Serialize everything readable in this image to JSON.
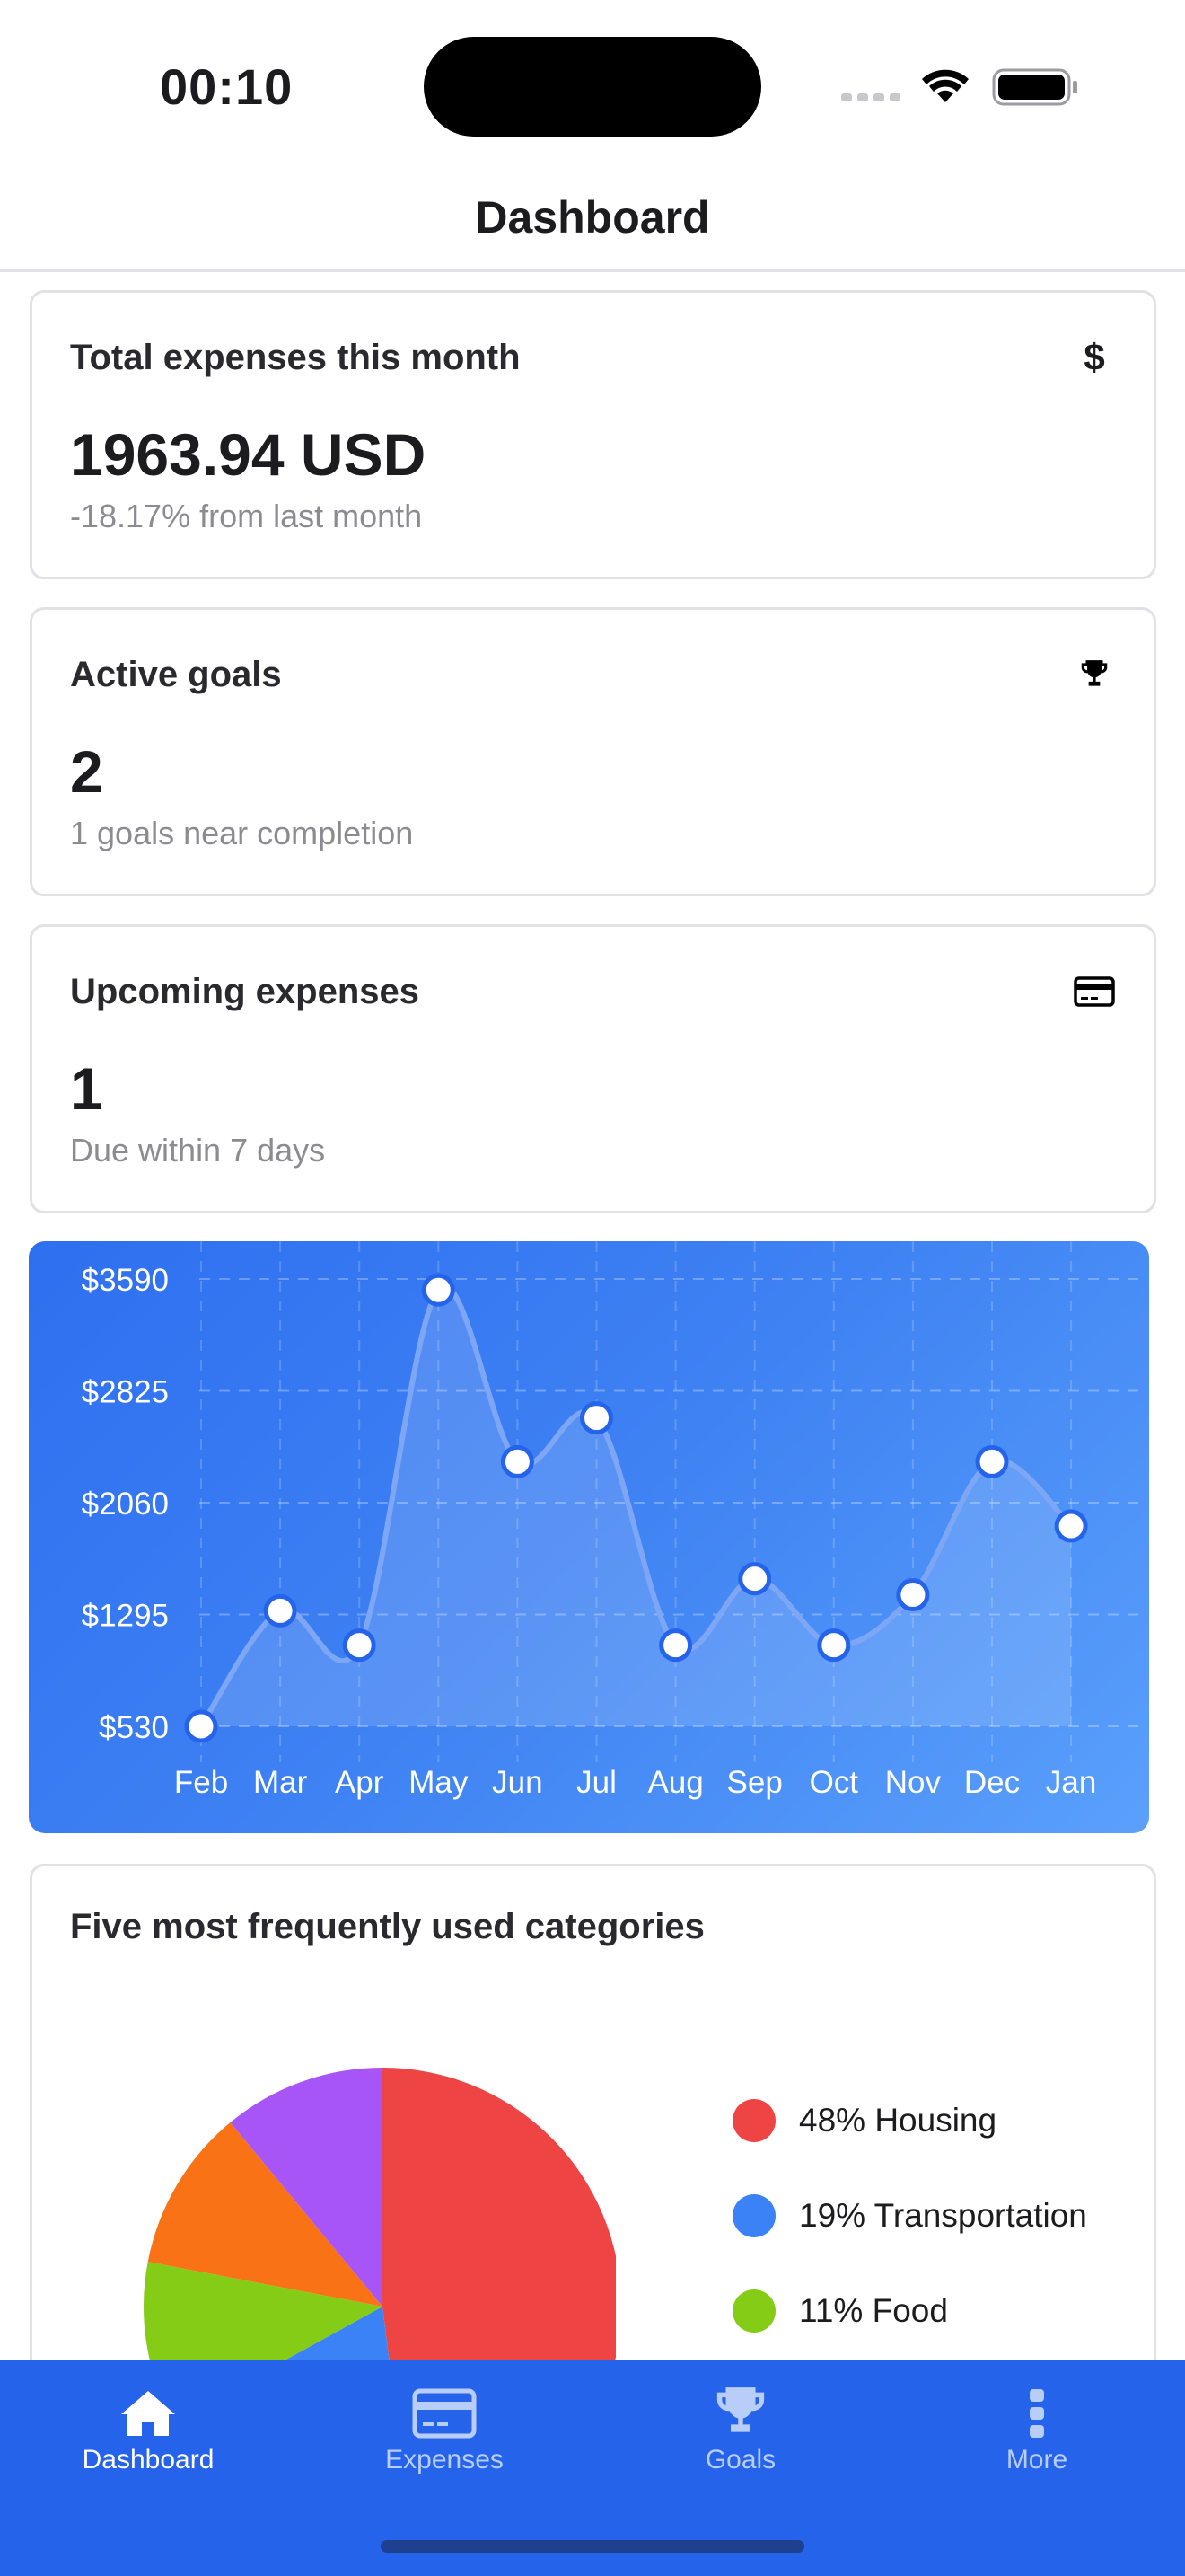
{
  "status_bar": {
    "time": "00:10"
  },
  "header": {
    "title": "Dashboard"
  },
  "cards": [
    {
      "title": "Total expenses this month",
      "value": "1963.94 USD",
      "subtitle": "-18.17% from last month",
      "icon": "dollar-icon",
      "icon_glyph": "$"
    },
    {
      "title": "Active goals",
      "value": "2",
      "subtitle": "1 goals near completion",
      "icon": "trophy-icon"
    },
    {
      "title": "Upcoming expenses",
      "value": "1",
      "subtitle": "Due within 7 days",
      "icon": "credit-card-icon"
    }
  ],
  "chart_data": {
    "type": "line",
    "categories": [
      "Feb",
      "Mar",
      "Apr",
      "May",
      "Jun",
      "Jul",
      "Aug",
      "Sep",
      "Oct",
      "Nov",
      "Dec",
      "Jan"
    ],
    "values": [
      530,
      1320,
      1085,
      3515,
      2340,
      2640,
      1085,
      1540,
      1085,
      1430,
      2340,
      1900
    ],
    "y_ticks": [
      "$3590",
      "$2825",
      "$2060",
      "$1295",
      "$530"
    ],
    "ylim": [
      530,
      3590
    ],
    "grid": true,
    "colors": {
      "line": "#7da6f5",
      "point_fill": "#ffffff",
      "point_stroke": "#2563eb",
      "text": "#ffffff"
    }
  },
  "categories_card": {
    "title": "Five most frequently used categories",
    "slices": [
      {
        "label": "48% Housing",
        "percent": 48,
        "color": "#ef4444"
      },
      {
        "label": "19% Transportation",
        "percent": 19,
        "color": "#3b82f6"
      },
      {
        "label": "11% Food",
        "percent": 11,
        "color": "#84cc16"
      },
      {
        "percent": 11,
        "color": "#f97316"
      },
      {
        "percent": 11,
        "color": "#a855f7"
      }
    ]
  },
  "tab_bar": {
    "items": [
      {
        "label": "Dashboard",
        "icon": "home-icon",
        "active": true
      },
      {
        "label": "Expenses",
        "icon": "credit-card-icon",
        "active": false
      },
      {
        "label": "Goals",
        "icon": "trophy-icon",
        "active": false
      },
      {
        "label": "More",
        "icon": "more-vertical-icon",
        "active": false
      }
    ]
  }
}
